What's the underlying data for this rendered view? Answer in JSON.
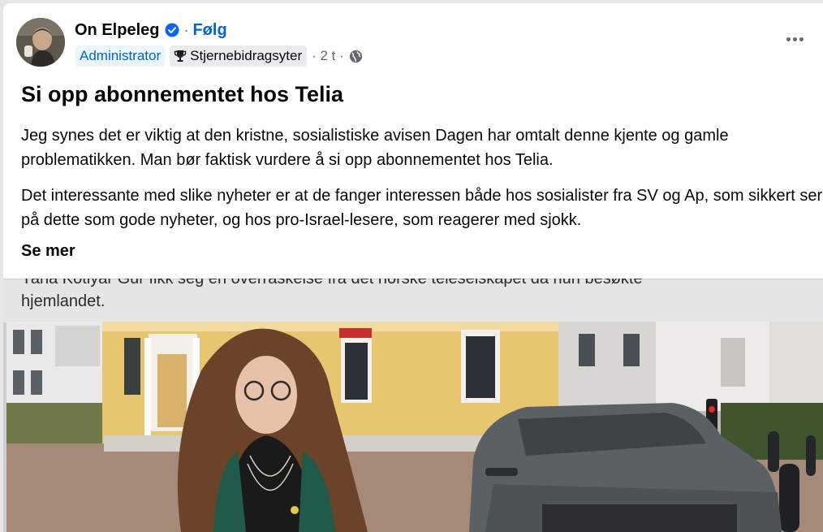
{
  "post": {
    "author": "On Elpeleg",
    "separator": "·",
    "follow": "Følg",
    "badge_admin": "Administrator",
    "badge_star": "Stjernebidragsyter",
    "time": "· 2 t ·",
    "title": "Si opp abonnementet hos Telia",
    "paragraph1": "Jeg synes det er viktig at den kristne, sosialistiske avisen Dagen har omtalt denne kjente og gamle problematikken. Man bør faktisk vurdere å si opp abonnementet hos Telia.",
    "paragraph2": "Det interessante med slike nyheter er at de fanger interessen både hos sosialister fra SV og Ap, som sikkert ser på dette som gode nyheter, og hos pro-Israel-lesere, som reagerer med sjokk.",
    "see_more": "Se mer"
  },
  "media": {
    "caption_line1": "Yana Kotlyar Gur fikk seg en overraskelse fra det norske teleselskapet da hun besøkte",
    "caption_line2": "hjemlandet."
  },
  "icons": {
    "verified": "verified-badge-icon",
    "trophy": "trophy-icon",
    "globe": "globe-icon",
    "more": "more-options-icon"
  },
  "colors": {
    "link_blue": "#0064d1",
    "admin_badge_bg": "#ebf5ff",
    "muted_text": "#65686c"
  }
}
